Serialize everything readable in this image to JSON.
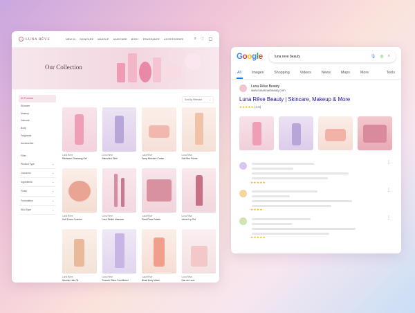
{
  "shop": {
    "brand": "LUNA RÊVE",
    "menu": [
      "NEW IN",
      "SKINCARE",
      "MAKEUP",
      "HAIRCARE",
      "BODY",
      "FRAGRANCE",
      "ACCESSORIES"
    ],
    "hero_title": "Our Collection",
    "sort_label": "Sort By: Relevant",
    "categories": [
      "All Products",
      "Skincare",
      "Makeup",
      "Haircare",
      "Body",
      "Fragrance",
      "Accessories"
    ],
    "filters_heading": "Filter",
    "filters": [
      "Product Type",
      "Concerns",
      "Ingredients",
      "Finish",
      "Formulation",
      "Skin Type"
    ],
    "products": [
      {
        "brand": "Luna Rêve",
        "name": "Radiance Cleansing Gel"
      },
      {
        "brand": "Luna Rêve",
        "name": "Bakuchiol Elixir"
      },
      {
        "brand": "Luna Rêve",
        "name": "Deep Moisture Cream"
      },
      {
        "brand": "Luna Rêve",
        "name": "Soft Blur Primer"
      },
      {
        "brand": "Luna Rêve",
        "name": "Soft Focus Cushion"
      },
      {
        "brand": "Luna Rêve",
        "name": "Lash Define Mascara"
      },
      {
        "brand": "Luna Rêve",
        "name": "Petal Rose Palette"
      },
      {
        "brand": "Luna Rêve",
        "name": "Velvet Lip Tint"
      },
      {
        "brand": "Luna Rêve",
        "name": "Nourish Hair Oil"
      },
      {
        "brand": "Luna Rêve",
        "name": "Smooth Shine Conditioner"
      },
      {
        "brand": "Luna Rêve",
        "name": "Blush Body Wash"
      },
      {
        "brand": "Luna Rêve",
        "name": "Eau de Luna"
      }
    ]
  },
  "search": {
    "logo": "Google",
    "query": "luna reve beauty",
    "tabs": [
      "All",
      "Images",
      "Shopping",
      "Videos",
      "News",
      "Maps",
      "More"
    ],
    "tools": "Tools",
    "result": {
      "site_name": "Luna Rêve Beauty",
      "url": "www.lunarevebeauty.com",
      "title": "Luna Rêve Beauty | Skincare, Makeup & More",
      "rating": "(4.6)",
      "stars": "★★★★★"
    },
    "other_ratings": [
      "★★★★★",
      "★★★★",
      "★★★★★"
    ]
  },
  "colors": {
    "accent": "#c04f78",
    "link": "#1a0dab",
    "google_blue": "#1a73e8"
  }
}
